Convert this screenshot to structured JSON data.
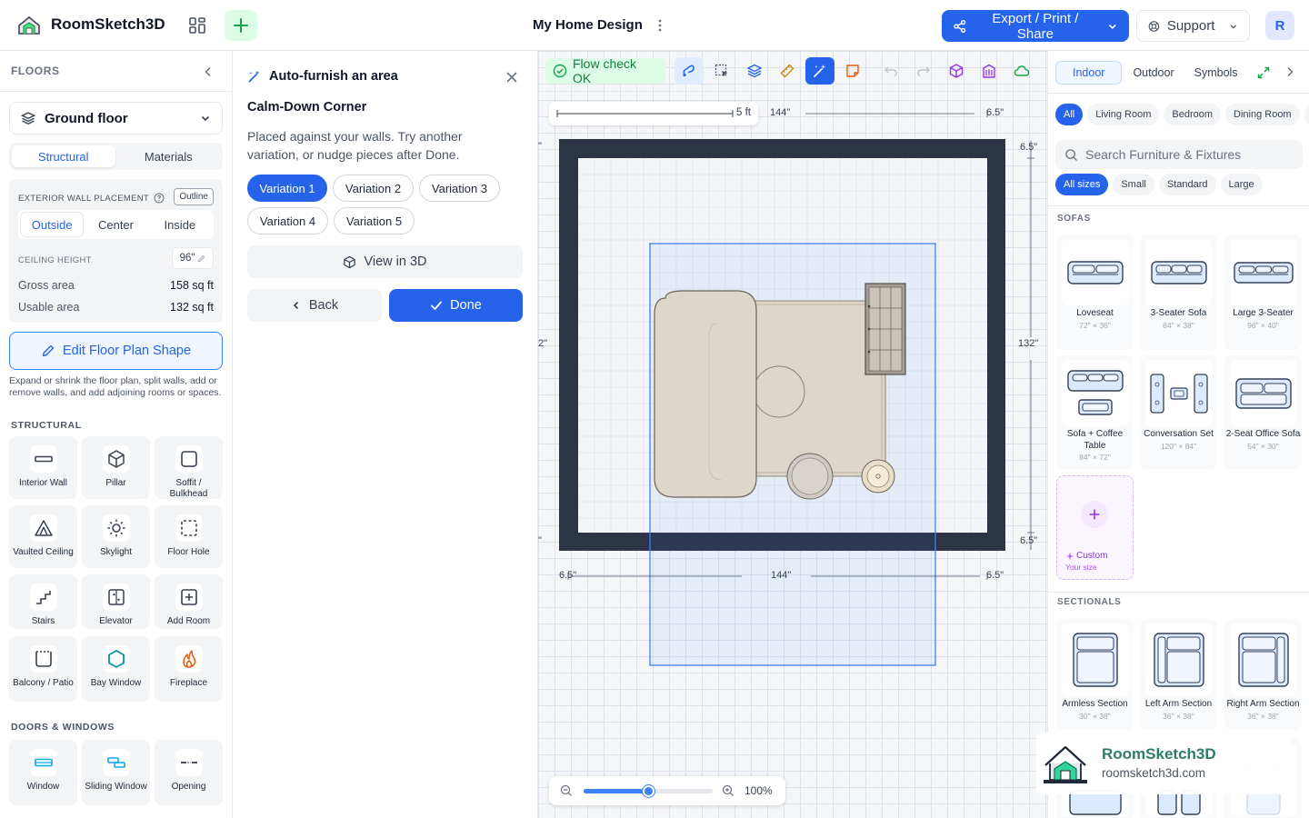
{
  "app": {
    "title": "RoomSketch3D",
    "doc_title": "My Home Design",
    "export_label": "Export / Print / Share",
    "support_label": "Support",
    "avatar_letter": "R"
  },
  "left": {
    "floors_header": "FLOORS",
    "floor_name": "Ground floor",
    "tabs": [
      "Structural",
      "Materials"
    ],
    "exterior_label": "EXTERIOR WALL PLACEMENT",
    "outline_label": "Outline",
    "placement_options": [
      "Outside",
      "Center",
      "Inside"
    ],
    "ceiling_label": "CEILING HEIGHT",
    "ceiling_value": "96\"",
    "gross_label": "Gross area",
    "gross_value": "158 sq ft",
    "usable_label": "Usable area",
    "usable_value": "132 sq ft",
    "edit_shape_label": "Edit Floor Plan Shape",
    "help_text": "Expand or shrink the floor plan, split walls, add or remove walls, and add adjoining rooms or spaces.",
    "structural_header": "STRUCTURAL",
    "structural_items": [
      "Interior Wall",
      "Pillar",
      "Soffit / Bulkhead",
      "Vaulted Ceiling",
      "Skylight",
      "Floor Hole",
      "Stairs",
      "Elevator",
      "Add Room",
      "Balcony / Patio",
      "Bay Window",
      "Fireplace"
    ],
    "doors_header": "DOORS & WINDOWS",
    "door_items": [
      "Window",
      "Sliding Window",
      "Opening"
    ]
  },
  "panel": {
    "title": "Auto-furnish an area",
    "subtitle": "Calm-Down Corner",
    "description": "Placed against your walls. Try another variation, or nudge pieces after Done.",
    "variations": [
      "Variation 1",
      "Variation 2",
      "Variation 3",
      "Variation 4",
      "Variation 5"
    ],
    "view3d_label": "View in 3D",
    "back_label": "Back",
    "done_label": "Done"
  },
  "canvas": {
    "flow_label": "Flow check OK",
    "scale_label": "5 ft",
    "dims": {
      "top_width": "144\"",
      "top_right": "6.5\"",
      "right_top": "6.5\"",
      "right_height": "132\"",
      "right_bottom": "6.5\"",
      "bottom_left": "6.5\"",
      "bottom_width": "144\"",
      "bottom_right": "6.5\"",
      "left_top": "\"",
      "left_mid": "2\"",
      "left_bottom": "\""
    },
    "zoom_value": "100%",
    "zoom_fraction": 0.5
  },
  "right": {
    "tabs": [
      "Indoor",
      "Outdoor",
      "Symbols"
    ],
    "room_chips": [
      "All",
      "Living Room",
      "Bedroom",
      "Dining Room"
    ],
    "search_placeholder": "Search Furniture & Fixtures",
    "size_chips": [
      "All sizes",
      "Small",
      "Standard",
      "Large"
    ],
    "sofas_header": "SOFAS",
    "sofas": [
      {
        "name": "Loveseat",
        "size": "72\" × 36\""
      },
      {
        "name": "3-Seater Sofa",
        "size": "84\" × 38\""
      },
      {
        "name": "Large 3-Seater",
        "size": "96\" × 40\""
      },
      {
        "name": "Sofa + Coffee Table",
        "size": "84\" × 72\""
      },
      {
        "name": "Conversation Set",
        "size": "120\" × 84\""
      },
      {
        "name": "2-Seat Office Sofa",
        "size": "54\" × 30\""
      }
    ],
    "custom_label": "Custom",
    "custom_sub": "Your size",
    "sectionals_header": "SECTIONALS",
    "sectionals": [
      {
        "name": "Armless Section",
        "size": "30\" × 38\""
      },
      {
        "name": "Left Arm Section",
        "size": "36\" × 38\""
      },
      {
        "name": "Right Arm Section",
        "size": "36\" × 38\""
      }
    ]
  },
  "brand": {
    "name": "RoomSketch3D",
    "url": "roomsketch3d.com"
  }
}
